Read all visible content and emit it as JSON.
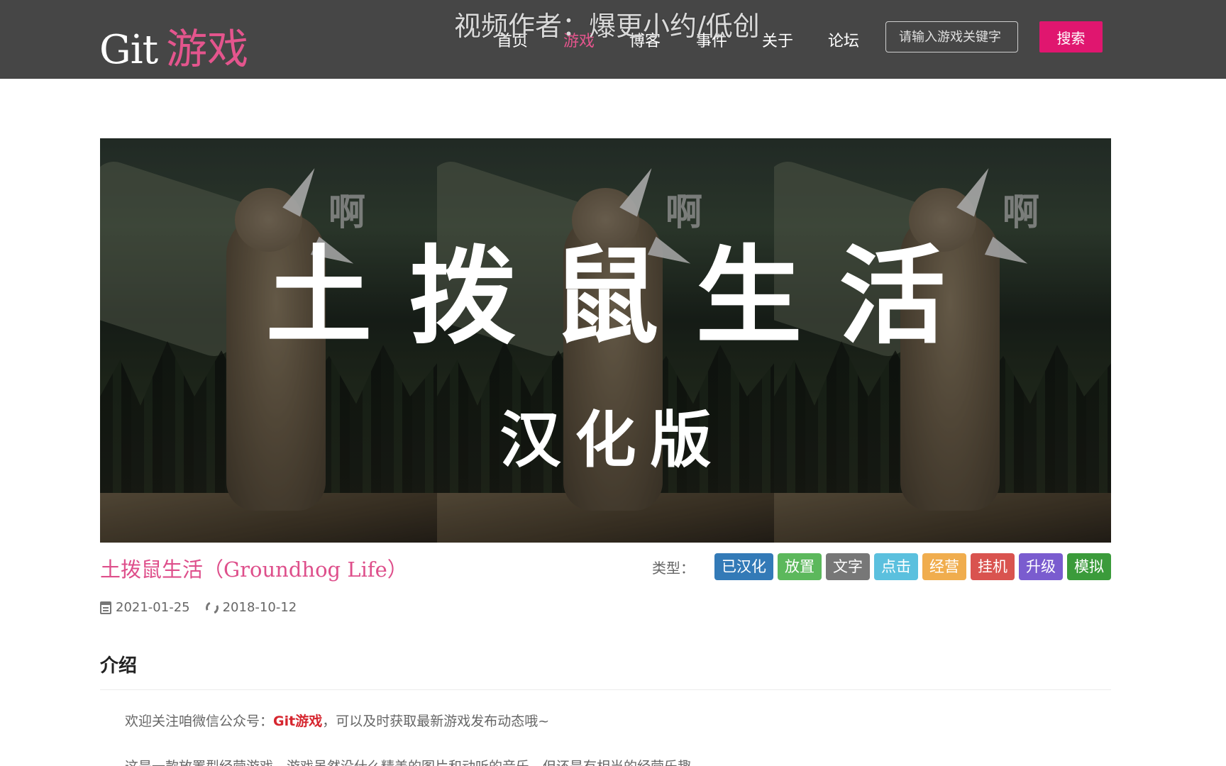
{
  "header": {
    "logo_git": "Git",
    "logo_game": "游戏",
    "watermark": "视频作者：爆更小约/低创",
    "nav": [
      {
        "label": "首页",
        "active": false
      },
      {
        "label": "游戏",
        "active": true
      },
      {
        "label": "博客",
        "active": false
      },
      {
        "label": "事件",
        "active": false
      },
      {
        "label": "关于",
        "active": false
      },
      {
        "label": "论坛",
        "active": false
      }
    ],
    "search_placeholder": "请输入游戏关键字",
    "search_button": "搜索"
  },
  "banner": {
    "title": "土拨鼠生活",
    "subtitle": "汉化版",
    "shout": "啊"
  },
  "game": {
    "title": "土拨鼠生活（Groundhog Life）",
    "tags_label": "类型：",
    "tags": [
      {
        "label": "已汉化",
        "color": "#337ab7"
      },
      {
        "label": "放置",
        "color": "#5cb85c"
      },
      {
        "label": "文字",
        "color": "#777777"
      },
      {
        "label": "点击",
        "color": "#5bc0de"
      },
      {
        "label": "经营",
        "color": "#f0ad4e"
      },
      {
        "label": "挂机",
        "color": "#d9534f"
      },
      {
        "label": "升级",
        "color": "#7a5ccf"
      },
      {
        "label": "模拟",
        "color": "#3b9b3b"
      }
    ],
    "published": "2021-01-25",
    "updated": "2018-10-12"
  },
  "intro": {
    "section_title": "介绍",
    "line1_before": "欢迎关注咱微信公众号：",
    "line1_highlight": "Git游戏",
    "line1_after": "，可以及时获取最新游戏发布动态哦~",
    "line2": "这是一款放置型经营游戏，游戏虽然没什么精美的图片和动听的音乐，但还是有相当的经营乐趣"
  },
  "colors": {
    "header_bg": "#464646",
    "accent_pink": "#e4558d",
    "search_button_bg": "#e0166f",
    "highlight_red": "#d6262f"
  }
}
